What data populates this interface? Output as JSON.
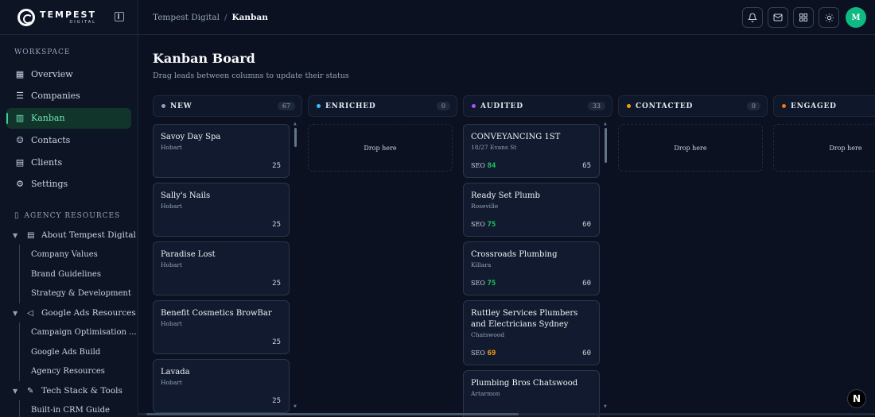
{
  "brand": {
    "name": "TEMPEST",
    "sub": "DIGITAL"
  },
  "sidebar": {
    "workspace_label": "WORKSPACE",
    "items": [
      {
        "label": "Overview",
        "icon": "grid-icon"
      },
      {
        "label": "Companies",
        "icon": "list-icon"
      },
      {
        "label": "Kanban",
        "icon": "kanban-icon",
        "active": true
      },
      {
        "label": "Contacts",
        "icon": "users-icon"
      },
      {
        "label": "Clients",
        "icon": "building-icon"
      },
      {
        "label": "Settings",
        "icon": "gear-icon"
      }
    ],
    "resources_label": "AGENCY RESOURCES",
    "tree": {
      "about": "About Tempest Digital",
      "about_children": [
        "Company Values",
        "Brand Guidelines",
        "Strategy & Development"
      ],
      "google": "Google Ads Resources",
      "google_children": [
        "Campaign Optimisation ...",
        "Google Ads Build",
        "Agency Resources"
      ],
      "tech": "Tech Stack & Tools",
      "tech_children": [
        "Built-in CRM Guide"
      ]
    }
  },
  "breadcrumb": {
    "parent": "Tempest Digital",
    "separator": "/",
    "current": "Kanban"
  },
  "user": {
    "initial": "M"
  },
  "page": {
    "title": "Kanban Board",
    "subtitle": "Drag leads between columns to update their status"
  },
  "drop_text": "Drop here",
  "columns": [
    {
      "title": "NEW",
      "count": "67",
      "color": "#94a3b8",
      "cards": [
        {
          "name": "Savoy Day Spa",
          "loc": "Hobart",
          "score": "25"
        },
        {
          "name": "Sally's Nails",
          "loc": "Hobart",
          "score": "25"
        },
        {
          "name": "Paradise Lost",
          "loc": "Hobart",
          "score": "25"
        },
        {
          "name": "Benefit Cosmetics BrowBar",
          "loc": "Hobart",
          "score": "25"
        },
        {
          "name": "Lavada",
          "loc": "Hobart",
          "score": "25"
        }
      ]
    },
    {
      "title": "ENRICHED",
      "count": "0",
      "color": "#38bdf8",
      "cards": []
    },
    {
      "title": "AUDITED",
      "count": "33",
      "color": "#a855f7",
      "cards": [
        {
          "name": "CONVEYANCING 1ST",
          "loc": "18/27 Evans St",
          "seo_label": "SEO",
          "seo": "84",
          "seo_color": "#22c55e",
          "score": "65"
        },
        {
          "name": "Ready Set Plumb",
          "loc": "Roseville",
          "seo_label": "SEO",
          "seo": "75",
          "seo_color": "#22c55e",
          "score": "60"
        },
        {
          "name": "Crossroads Plumbing",
          "loc": "Killara",
          "seo_label": "SEO",
          "seo": "75",
          "seo_color": "#22c55e",
          "score": "60"
        },
        {
          "name": "Ruttley Services Plumbers and Electricians Sydney",
          "loc": "Chatswood",
          "seo_label": "SEO",
          "seo": "69",
          "seo_color": "#f59e0b",
          "score": "60"
        },
        {
          "name": "Plumbing Bros Chatswood",
          "loc": "Artarmon"
        }
      ]
    },
    {
      "title": "CONTACTED",
      "count": "0",
      "color": "#f59e0b",
      "cards": []
    },
    {
      "title": "ENGAGED",
      "count": "",
      "color": "#f97316",
      "cards": []
    }
  ],
  "next_badge": "N"
}
